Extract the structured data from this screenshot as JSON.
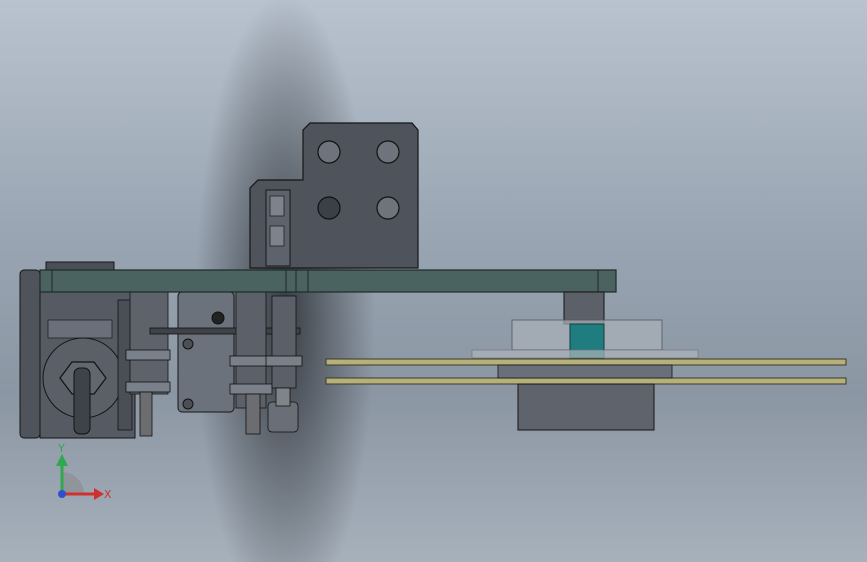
{
  "viewport": {
    "background_top": "#b9c3cf",
    "background_bottom": "#8b96a3"
  },
  "colors": {
    "plate": "#4a6360",
    "plate_edge": "#1e2a28",
    "metal_dark": "#4e535c",
    "metal_mid": "#6c727c",
    "metal_light": "#9aa0a8",
    "rail": "#b6b07a",
    "coupling": "#1f7d80",
    "axis_x": "#d0312d",
    "axis_y": "#2fa84f",
    "axis_z": "#2f4fd0"
  },
  "triad": {
    "x_label": "X",
    "y_label": "Y"
  }
}
